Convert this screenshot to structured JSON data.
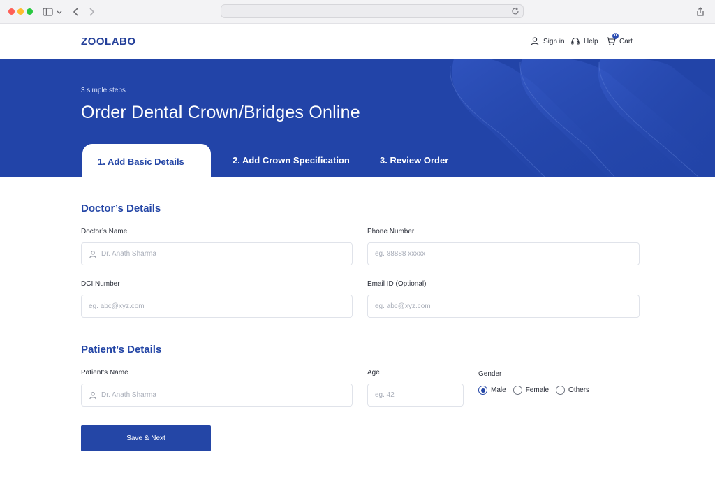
{
  "browser": {
    "url": ""
  },
  "header": {
    "logo": "ZOOLABO",
    "sign_in": "Sign in",
    "help": "Help",
    "cart": "Cart",
    "cart_count": "0"
  },
  "banner": {
    "steps_note": "3 simple steps",
    "title": "Order Dental Crown/Bridges Online",
    "tabs": [
      {
        "label": "1. Add Basic Details",
        "active": true
      },
      {
        "label": "2. Add Crown Specification",
        "active": false
      },
      {
        "label": "3. Review Order",
        "active": false
      }
    ]
  },
  "doctor": {
    "section_title": "Doctor’s Details",
    "name_label": "Doctor’s Name",
    "name_placeholder": "Dr. Anath Sharma",
    "phone_label": "Phone Number",
    "phone_placeholder": "eg. 88888 xxxxx",
    "dci_label": "DCI Number",
    "dci_placeholder": "eg. abc@xyz.com",
    "email_label": "Email ID (Optional)",
    "email_placeholder": "eg. abc@xyz.com"
  },
  "patient": {
    "section_title": "Patient’s Details",
    "name_label": "Patient’s Name",
    "name_placeholder": "Dr. Anath Sharma",
    "age_label": "Age",
    "age_placeholder": "eg. 42",
    "gender_label": "Gender",
    "gender_options": [
      "Male",
      "Female",
      "Others"
    ],
    "gender_selected": "Male"
  },
  "actions": {
    "save_next": "Save & Next"
  },
  "colors": {
    "brand": "#2446a6",
    "banner": "#2244a8"
  }
}
